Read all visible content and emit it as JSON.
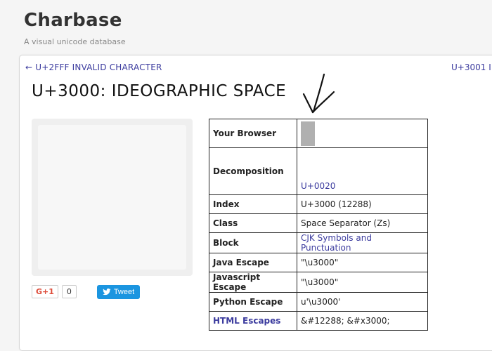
{
  "site": {
    "title": "Charbase",
    "tagline": "A visual unicode database"
  },
  "nav": {
    "prev": "← U+2FFF INVALID CHARACTER",
    "next": "U+3001 I"
  },
  "character": {
    "heading": "U+3000: IDEOGRAPHIC SPACE"
  },
  "social": {
    "gplus_label": "G+1",
    "gplus_count": "0",
    "tweet_label": "Tweet"
  },
  "info_table": {
    "rows": [
      {
        "key": "Your Browser",
        "value": ""
      },
      {
        "key": "Decomposition",
        "value": "U+0020"
      },
      {
        "key": "Index",
        "value": "U+3000 (12288)"
      },
      {
        "key": "Class",
        "value": "Space Separator (Zs)"
      },
      {
        "key": "Block",
        "value": "CJK Symbols and Punctuation"
      },
      {
        "key": "Java Escape",
        "value": "\"\\u3000\""
      },
      {
        "key": "Javascript Escape",
        "value": "\"\\u3000\""
      },
      {
        "key": "Python Escape",
        "value": "u'\\u3000'"
      },
      {
        "key": "HTML Escapes",
        "value": "&#12288; &#x3000;"
      }
    ]
  },
  "colors": {
    "link": "#3b3b9e",
    "tweet": "#1b95e0",
    "gplus": "#dd4b39"
  }
}
